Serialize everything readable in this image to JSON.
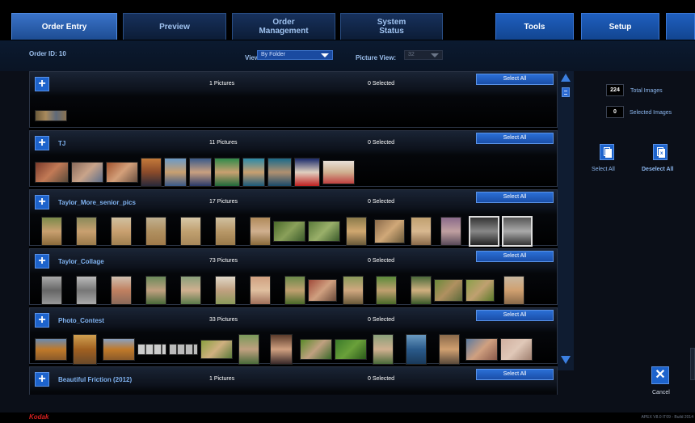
{
  "nav": {
    "tabs": [
      {
        "label": "Order Entry",
        "active": true
      },
      {
        "label": "Preview",
        "active": false
      },
      {
        "label": "Order\nManagement",
        "active": false
      },
      {
        "label": "System\nStatus",
        "active": false
      },
      {
        "label": "Tools",
        "active": false
      },
      {
        "label": "Setup",
        "active": false
      }
    ]
  },
  "header": {
    "order_id": "Order ID: 10",
    "view_label": "View:",
    "view_value": "By Folder",
    "picture_view_label": "Picture View:",
    "picture_view_value": "32"
  },
  "folders": [
    {
      "name": "",
      "count": "1 Pictures",
      "selected": "0 Selected",
      "select_all": "Select All"
    },
    {
      "name": "TJ",
      "count": "11 Pictures",
      "selected": "0 Selected",
      "select_all": "Select All"
    },
    {
      "name": "Taylor_More_senior_pics",
      "count": "17 Pictures",
      "selected": "0 Selected",
      "select_all": "Select All"
    },
    {
      "name": "Taylor_Collage",
      "count": "73 Pictures",
      "selected": "0 Selected",
      "select_all": "Select All"
    },
    {
      "name": "Photo_Contest",
      "count": "33 Pictures",
      "selected": "0 Selected",
      "select_all": "Select All"
    },
    {
      "name": "Beautiful Friction (2012)",
      "count": "1 Pictures",
      "selected": "0 Selected",
      "select_all": "Select All"
    }
  ],
  "stats": {
    "total_images_value": "224",
    "total_images_label": "Total Images",
    "selected_images_value": "0",
    "selected_images_label": "Selected Images"
  },
  "actions": {
    "select_all": "Select All",
    "deselect_all": "Deselect All",
    "cancel": "Cancel"
  },
  "footer": {
    "logo": "Kodak",
    "build": "APEX V8.0 IT09 - Build 2014"
  },
  "colors": {
    "accent": "#1d63cc",
    "nav_active": "#3a73c9",
    "folder_name": "#7fb2f0",
    "brand": "#d41f1f"
  }
}
